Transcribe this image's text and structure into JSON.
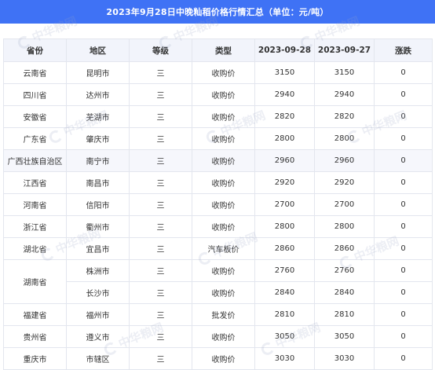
{
  "title": "2023年9月28日中晚籼稻价格行情汇总（单位：元/吨）",
  "watermark_text": "中华粮网",
  "headers": [
    "省份",
    "地区",
    "等级",
    "类型",
    "2023-09-28",
    "2023-09-27",
    "涨跌"
  ],
  "rows": [
    {
      "province": "云南省",
      "region": "昆明市",
      "grade": "三",
      "type": "收购价",
      "d0928": "3150",
      "d0927": "3150",
      "change": "0"
    },
    {
      "province": "四川省",
      "region": "达州市",
      "grade": "三",
      "type": "收购价",
      "d0928": "2940",
      "d0927": "2940",
      "change": "0"
    },
    {
      "province": "安徽省",
      "region": "芜湖市",
      "grade": "三",
      "type": "收购价",
      "d0928": "2820",
      "d0927": "2820",
      "change": "0"
    },
    {
      "province": "广东省",
      "region": "肇庆市",
      "grade": "三",
      "type": "收购价",
      "d0928": "2800",
      "d0927": "2800",
      "change": "0"
    },
    {
      "province": "广西壮族自治区",
      "region": "南宁市",
      "grade": "三",
      "type": "收购价",
      "d0928": "2960",
      "d0927": "2960",
      "change": "0"
    },
    {
      "province": "江西省",
      "region": "南昌市",
      "grade": "三",
      "type": "收购价",
      "d0928": "2920",
      "d0927": "2920",
      "change": "0"
    },
    {
      "province": "河南省",
      "region": "信阳市",
      "grade": "三",
      "type": "收购价",
      "d0928": "2700",
      "d0927": "2700",
      "change": "0"
    },
    {
      "province": "浙江省",
      "region": "衢州市",
      "grade": "三",
      "type": "收购价",
      "d0928": "2800",
      "d0927": "2800",
      "change": "0"
    },
    {
      "province": "湖北省",
      "region": "宜昌市",
      "grade": "三",
      "type": "汽车板价",
      "d0928": "2860",
      "d0927": "2860",
      "change": "0"
    },
    {
      "province": "湖南省",
      "region": "株洲市",
      "grade": "三",
      "type": "收购价",
      "d0928": "2760",
      "d0927": "2760",
      "change": "0"
    },
    {
      "province": "",
      "region": "长沙市",
      "grade": "三",
      "type": "收购价",
      "d0928": "2840",
      "d0927": "2840",
      "change": "0"
    },
    {
      "province": "福建省",
      "region": "福州市",
      "grade": "三",
      "type": "批发价",
      "d0928": "2810",
      "d0927": "2810",
      "change": "0"
    },
    {
      "province": "贵州省",
      "region": "遵义市",
      "grade": "三",
      "type": "收购价",
      "d0928": "3050",
      "d0927": "3050",
      "change": "0"
    },
    {
      "province": "重庆市",
      "region": "市辖区",
      "grade": "三",
      "type": "收购价",
      "d0928": "3030",
      "d0927": "3030",
      "change": "0"
    }
  ]
}
